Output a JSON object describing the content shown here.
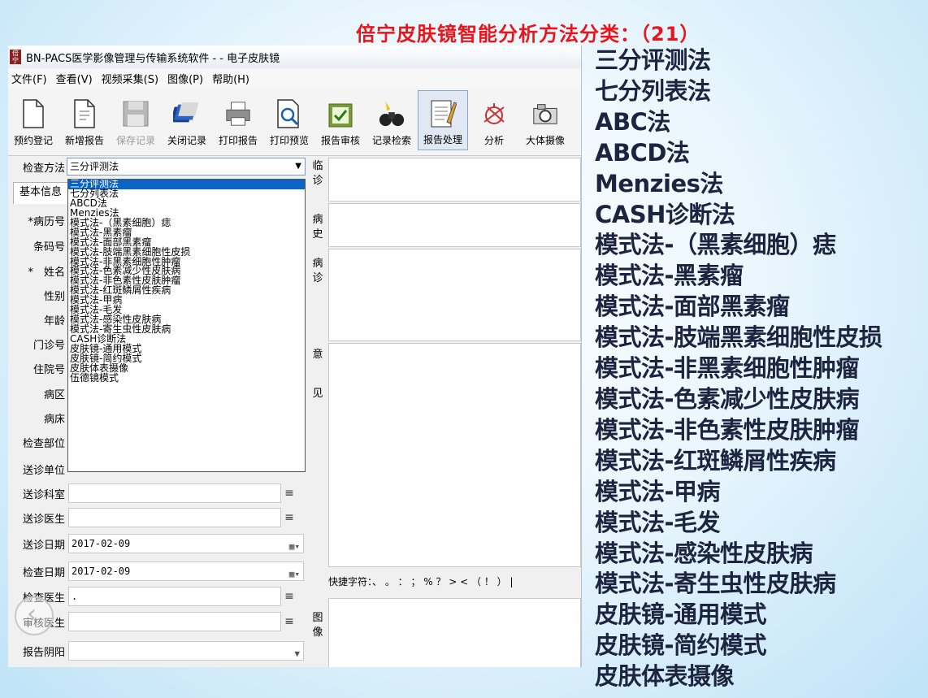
{
  "slide": {
    "title": "倍宁皮肤镜智能分析方法分类：（21）",
    "methods": [
      "三分评测法",
      "七分列表法",
      "ABC法",
      "ABCD法",
      "Menzies法",
      "CASH诊断法",
      "模式法-（黑素细胞）痣",
      "模式法-黑素瘤",
      "模式法-面部黑素瘤",
      "模式法-肢端黑素细胞性皮损",
      "模式法-非黑素细胞性肿瘤",
      "模式法-色素减少性皮肤病",
      "模式法-非色素性皮肤肿瘤",
      "模式法-红斑鳞屑性疾病",
      "模式法-甲病",
      "模式法-毛发",
      "模式法-感染性皮肤病",
      "模式法-寄生虫性皮肤病",
      "皮肤镜-通用模式",
      "皮肤镜-简约模式",
      "皮肤体表摄像"
    ]
  },
  "window": {
    "title": "BN-PACS医学影像管理与传输系统软件 - - 电子皮肤镜",
    "logo_text": "倍宁医学",
    "menu": [
      "文件(F)",
      "查看(V)",
      "视频采集(S)",
      "图像(P)",
      "帮助(H)"
    ],
    "toolbar": [
      {
        "label": "预约登记",
        "icon": "blank-page-icon"
      },
      {
        "label": "新增报告",
        "icon": "new-page-icon"
      },
      {
        "label": "保存记录",
        "icon": "floppy-disk-icon"
      },
      {
        "label": "关闭记录",
        "icon": "close-books-icon"
      },
      {
        "label": "打印报告",
        "icon": "printer-icon"
      },
      {
        "label": "打印预览",
        "icon": "magnifier-page-icon"
      },
      {
        "label": "报告审核",
        "icon": "check-clipboard-icon"
      },
      {
        "label": "记录检索",
        "icon": "binoculars-icon"
      },
      {
        "label": "报告处理",
        "icon": "notepad-pencil-icon"
      },
      {
        "label": "分析",
        "icon": "analysis-icon"
      },
      {
        "label": "大体摄像",
        "icon": "camera-icon"
      }
    ]
  },
  "form": {
    "exam_method_label": "检查方法",
    "exam_method_value": "三分评测法",
    "dropdown_options": [
      "三分评测法",
      "七分列表法",
      "ABCD法",
      "Menzies法",
      "模式法-（黑素细胞）痣",
      "模式法-黑素瘤",
      "模式法-面部黑素瘤",
      "模式法-肢端黑素细胞性皮损",
      "模式法-非黑素细胞性肿瘤",
      "模式法-色素减少性皮肤病",
      "模式法-非色素性皮肤肿瘤",
      "模式法-红斑鳞屑性疾病",
      "模式法-甲病",
      "模式法-毛发",
      "模式法-感染性皮肤病",
      "模式法-寄生虫性皮肤病",
      "CASH诊断法",
      "皮肤镜-通用模式",
      "皮肤镜-简约模式",
      "皮肤体表摄像",
      "伍德镜模式"
    ],
    "basic_info_tab": "基本信息",
    "labels": {
      "record_no": "*病历号",
      "barcode": "条码号",
      "name": "*　姓名",
      "gender": "性别",
      "age": "年龄",
      "clinic_no": "门诊号",
      "inpatient_no": "住院号",
      "ward": "病区",
      "bed": "病床",
      "exam_part": "检查部位",
      "send_unit": "送诊单位",
      "send_dept": "送诊科室",
      "send_doctor": "送诊医生",
      "send_date": "送诊日期",
      "exam_date": "检查日期",
      "exam_doctor": "检查医生",
      "review_doctor": "审核医生",
      "report_result": "报告阴阳"
    },
    "send_date_value": "2017-02-09",
    "exam_date_value": "2017-02-09",
    "exam_doctor_value": ".",
    "list_glyph": "≡",
    "calendar_glyph": "▦▾"
  },
  "right": {
    "clinical_label": "临诊",
    "history_label": "病史",
    "diagnosis_label": "病诊",
    "opinion_label_1": "意",
    "opinion_label_2": "见",
    "image_label": "图像",
    "shortcut_text": "快捷字符：、 。 ： ； % ？ > < （ ！ ） |"
  }
}
